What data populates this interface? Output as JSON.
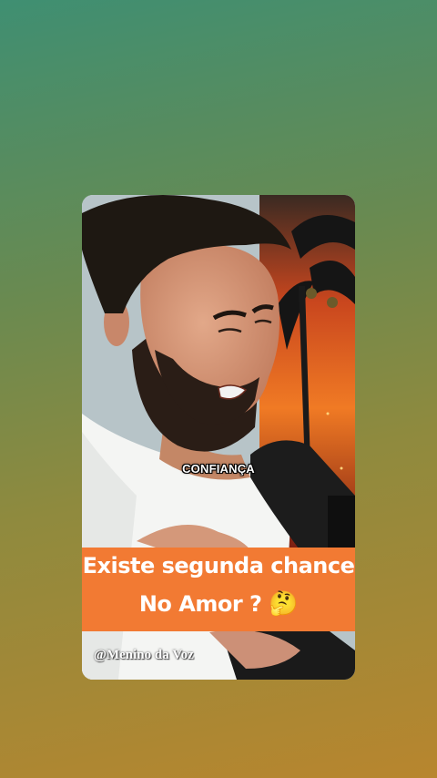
{
  "video": {
    "subtitle_word": "CONFIANÇA",
    "headline_line1": "Existe segunda chance",
    "headline_line2": "No Amor ?",
    "headline_emoji": "🤔",
    "watermark": "@Menino da Voz"
  },
  "colors": {
    "banner": "#f27a33",
    "background_top": "#3f8f72",
    "background_bottom": "#b8862e"
  }
}
